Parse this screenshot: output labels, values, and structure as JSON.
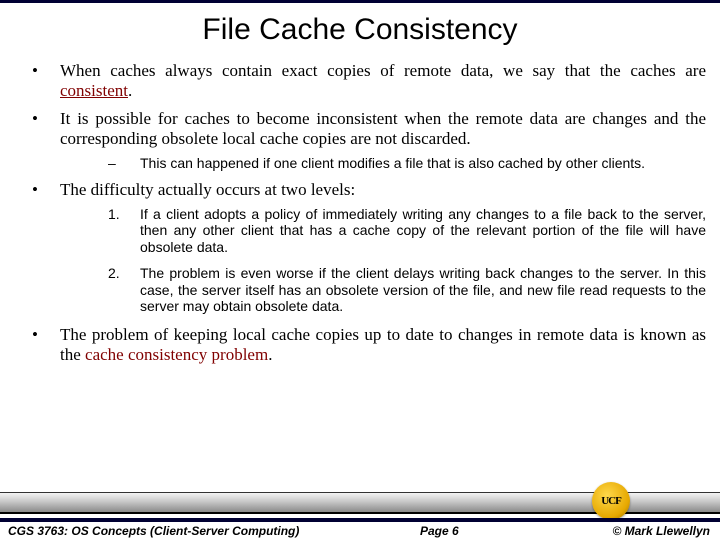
{
  "title": "File Cache Consistency",
  "bullets": {
    "b1a": "When caches always contain exact copies of remote data, we say that the caches are ",
    "b1b": "consistent",
    "b1c": ".",
    "b2": "It is possible for caches to become inconsistent when the remote data are changes and the corresponding obsolete local cache copies are not discarded.",
    "sub1": "This can happened if one client modifies a file that is also cached by other clients.",
    "b3": "The difficulty actually occurs at two levels:",
    "n1": "If a client adopts a policy of immediately writing any changes to a file back to the server, then any other client that has a cache copy of the relevant portion of the file will have obsolete data.",
    "n2": "The problem is even worse if the client delays writing back changes to the server. In this case, the server itself has an obsolete version of the file, and new file read requests to the server may obtain obsolete data.",
    "b4a": "The problem of keeping local cache copies up to date to changes in remote data is known as the ",
    "b4b": "cache consistency problem",
    "b4c": "."
  },
  "footer": {
    "course": "CGS 3763: OS Concepts  (Client-Server Computing)",
    "page": "Page 6",
    "copyright": "© Mark Llewellyn",
    "logo_text": "UCF"
  }
}
